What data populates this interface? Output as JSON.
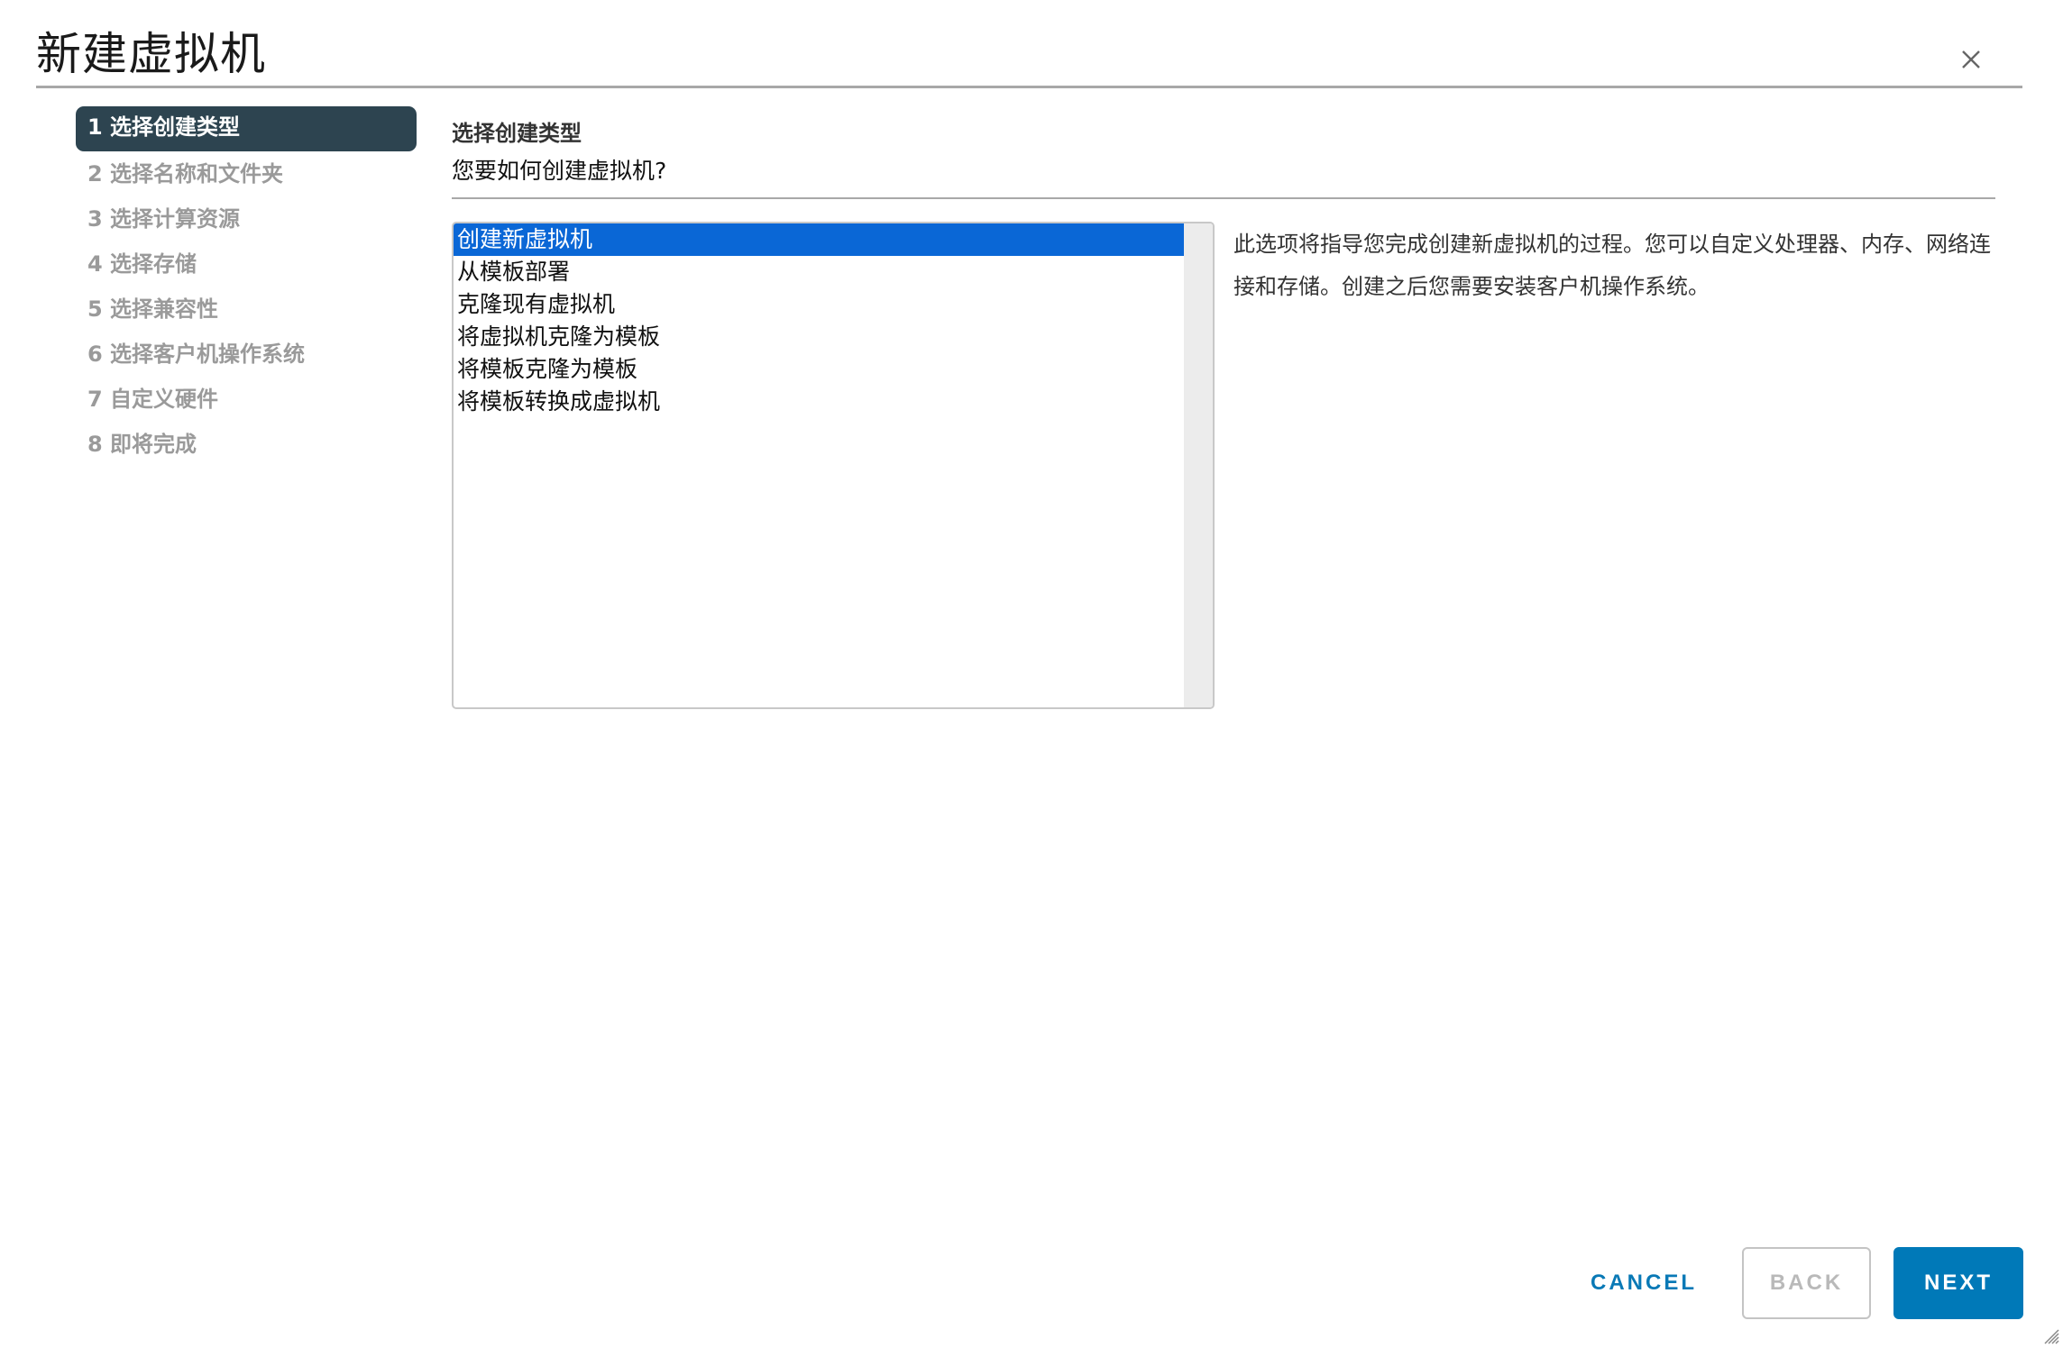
{
  "dialog": {
    "title": "新建虚拟机",
    "close_icon": "close-icon"
  },
  "steps": [
    {
      "label": "1 选择创建类型",
      "active": true
    },
    {
      "label": "2 选择名称和文件夹",
      "active": false
    },
    {
      "label": "3 选择计算资源",
      "active": false
    },
    {
      "label": "4 选择存储",
      "active": false
    },
    {
      "label": "5 选择兼容性",
      "active": false
    },
    {
      "label": "6 选择客户机操作系统",
      "active": false
    },
    {
      "label": "7 自定义硬件",
      "active": false
    },
    {
      "label": "8 即将完成",
      "active": false
    }
  ],
  "content": {
    "heading": "选择创建类型",
    "question": "您要如何创建虚拟机?",
    "creation_types": [
      {
        "label": "创建新虚拟机",
        "selected": true
      },
      {
        "label": "从模板部署",
        "selected": false
      },
      {
        "label": "克隆现有虚拟机",
        "selected": false
      },
      {
        "label": "将虚拟机克隆为模板",
        "selected": false
      },
      {
        "label": "将模板克隆为模板",
        "selected": false
      },
      {
        "label": "将模板转换成虚拟机",
        "selected": false
      }
    ],
    "description": "此选项将指导您完成创建新虚拟机的过程。您可以自定义处理器、内存、网络连接和存储。创建之后您需要安装客户机操作系统。"
  },
  "footer": {
    "cancel_label": "CANCEL",
    "back_label": "BACK",
    "back_disabled": true,
    "next_label": "NEXT"
  },
  "colors": {
    "active_step_bg": "#2d4450",
    "selection_blue": "#0a67d6",
    "primary_button": "#0079b8",
    "link_blue": "#0979b6"
  }
}
